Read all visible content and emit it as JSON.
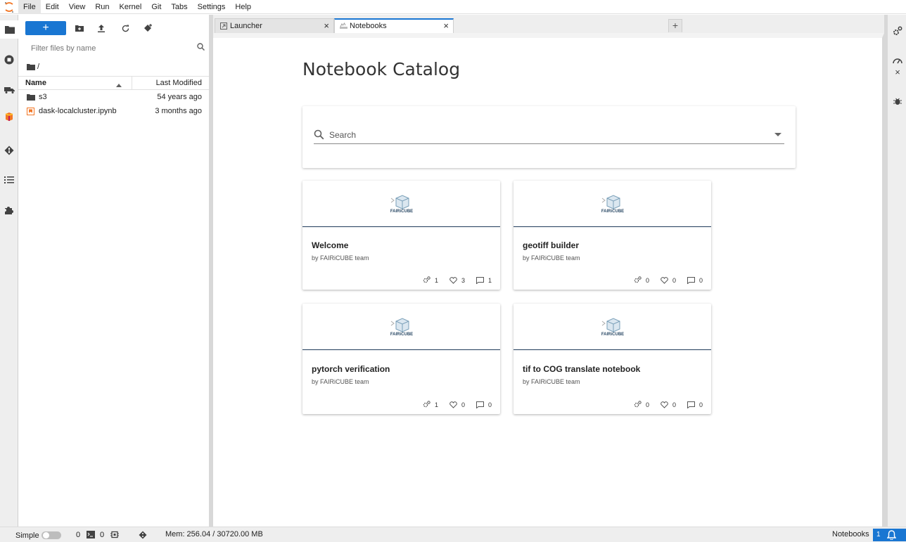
{
  "menubar": {
    "items": [
      "File",
      "Edit",
      "View",
      "Run",
      "Kernel",
      "Git",
      "Tabs",
      "Settings",
      "Help"
    ]
  },
  "file_browser": {
    "new_label": "+",
    "filter_placeholder": "Filter files by name",
    "breadcrumb": "/",
    "columns": {
      "name": "Name",
      "modified": "Last Modified"
    },
    "files": [
      {
        "name": "s3",
        "type": "folder",
        "modified": "54 years ago"
      },
      {
        "name": "dask-localcluster.ipynb",
        "type": "notebook",
        "modified": "3 months ago"
      }
    ]
  },
  "tabs": [
    {
      "label": "Launcher",
      "icon": "launcher-icon",
      "active": false
    },
    {
      "label": "Notebooks",
      "icon": "notebooks-icon",
      "active": true
    }
  ],
  "catalog": {
    "title": "Notebook Catalog",
    "search_placeholder": "Search",
    "logo_text": "FAIRiCUBE",
    "cards": [
      {
        "title": "Welcome",
        "author": "by FAIRiCUBE team",
        "runs": "1",
        "likes": "3",
        "comments": "1"
      },
      {
        "title": "geotiff builder",
        "author": "by FAIRiCUBE team",
        "runs": "0",
        "likes": "0",
        "comments": "0"
      },
      {
        "title": "pytorch verification",
        "author": "by FAIRiCUBE team",
        "runs": "1",
        "likes": "0",
        "comments": "0"
      },
      {
        "title": "tif to COG translate notebook",
        "author": "by FAIRiCUBE team",
        "runs": "0",
        "likes": "0",
        "comments": "0"
      }
    ]
  },
  "statusbar": {
    "simple_label": "Simple",
    "terminals": "0",
    "kernels": "0",
    "memory": "Mem: 256.04 / 30720.00 MB",
    "mode": "Notebooks",
    "notifications": "1"
  },
  "colors": {
    "accent": "#1976d2",
    "jupyter_orange": "#f37726"
  }
}
